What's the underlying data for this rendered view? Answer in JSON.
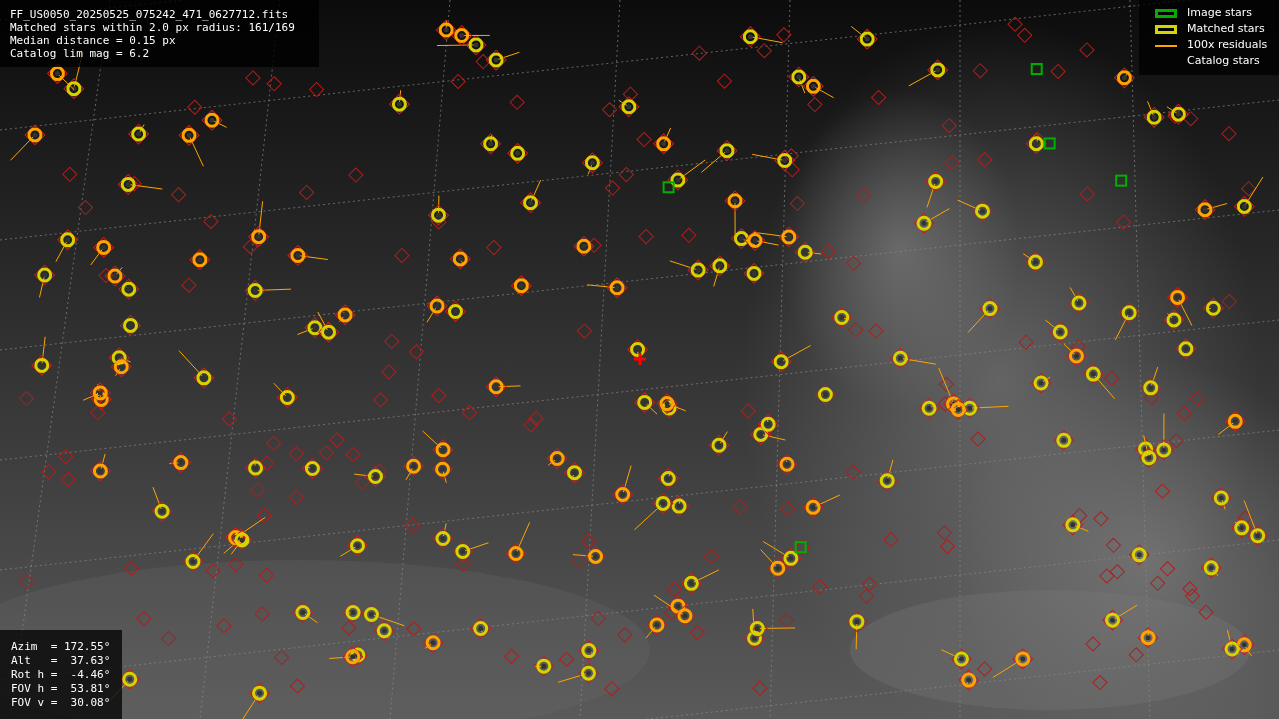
{
  "info_lines": [
    "FF_US0050_20250525_075242_471_0627712.fits",
    "Matched stars within 2.0 px radius: 161/169",
    "Median distance = 0.15 px",
    "Catalog lim mag = 6.2"
  ],
  "legend": [
    {
      "label": "Image stars",
      "kind": "box",
      "color": "#00b000"
    },
    {
      "label": "Matched stars",
      "kind": "box",
      "color": "#d4d400"
    },
    {
      "label": "100x residuals",
      "kind": "line",
      "color": "#ffa500"
    },
    {
      "label": "Catalog stars",
      "kind": "none"
    }
  ],
  "pointing_lines": [
    "Azim  = 172.55°",
    "Alt   =  37.63°",
    "Rot h =  -4.46°",
    "FOV h =  53.81°",
    "FOV v =  30.08°"
  ]
}
